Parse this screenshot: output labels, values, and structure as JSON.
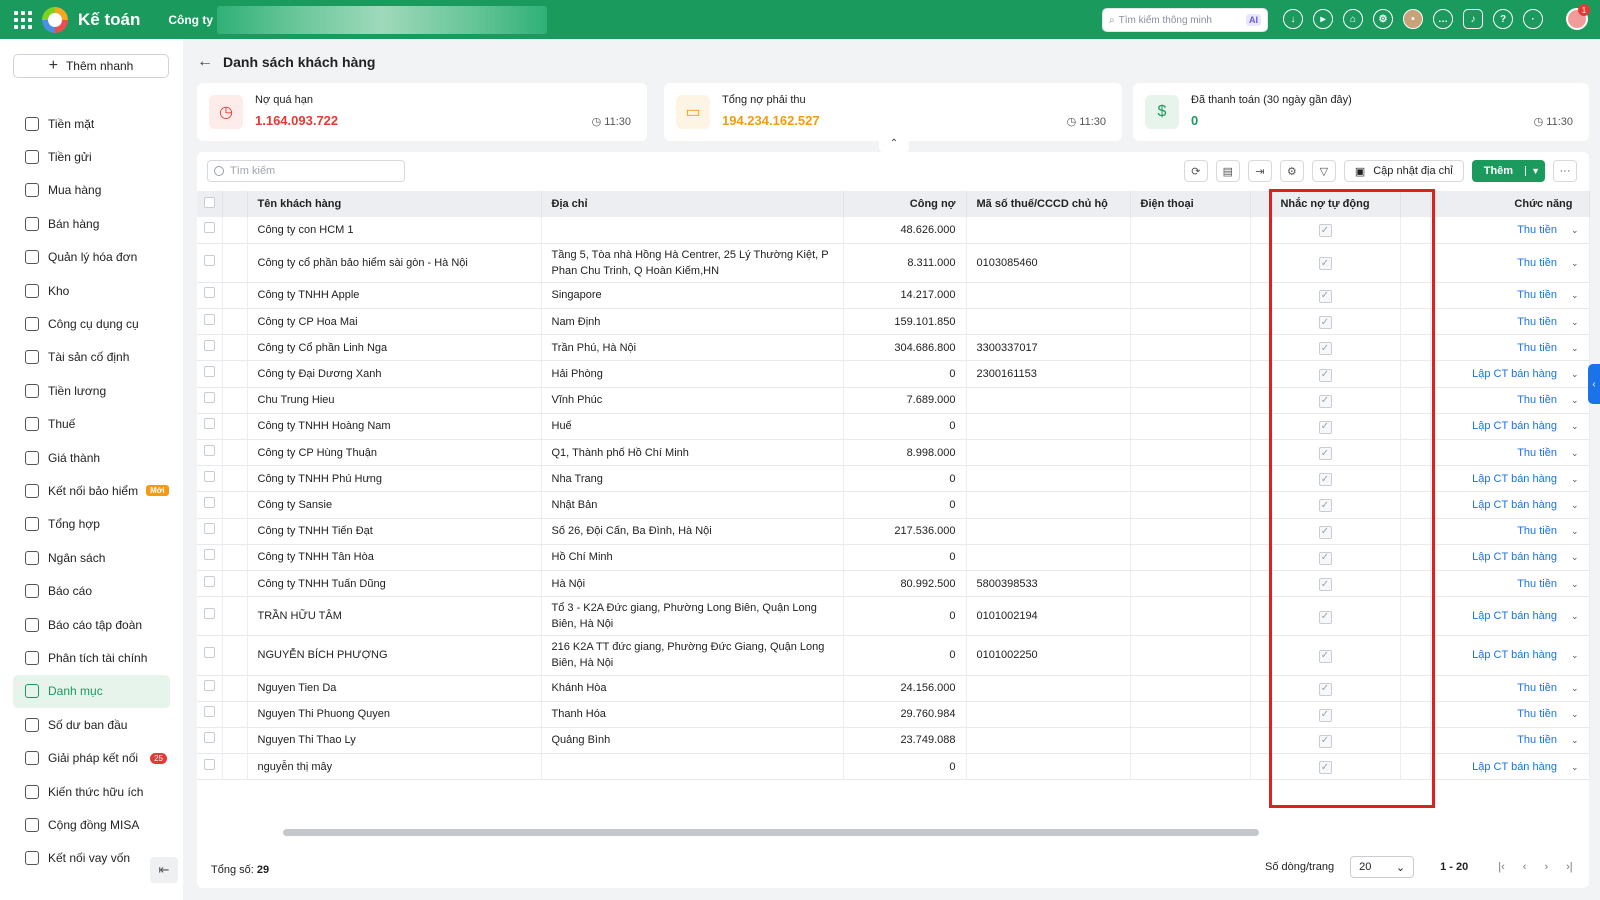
{
  "topbar": {
    "app_title": "Kế toán",
    "company_label": "Công ty",
    "search_placeholder": "Tìm kiếm thông minh",
    "search_ai": "AI",
    "notification_count": "1"
  },
  "sidebar": {
    "quick_add": "Thêm nhanh",
    "items": [
      {
        "label": "Tiền mặt",
        "icon": "cash-icon"
      },
      {
        "label": "Tiền gửi",
        "icon": "bank-icon"
      },
      {
        "label": "Mua hàng",
        "icon": "shopping-bag-icon"
      },
      {
        "label": "Bán hàng",
        "icon": "cart-icon"
      },
      {
        "label": "Quản lý hóa đơn",
        "icon": "invoice-icon"
      },
      {
        "label": "Kho",
        "icon": "warehouse-icon"
      },
      {
        "label": "Công cụ dụng cụ",
        "icon": "tools-icon"
      },
      {
        "label": "Tài sản cố định",
        "icon": "car-icon"
      },
      {
        "label": "Tiền lương",
        "icon": "salary-icon"
      },
      {
        "label": "Thuế",
        "icon": "tax-icon"
      },
      {
        "label": "Giá thành",
        "icon": "price-tag-icon"
      },
      {
        "label": "Kết nối bảo hiểm",
        "icon": "shield-icon",
        "tag": "Mới"
      },
      {
        "label": "Tổng hợp",
        "icon": "summary-icon"
      },
      {
        "label": "Ngân sách",
        "icon": "budget-icon"
      },
      {
        "label": "Báo cáo",
        "icon": "bar-chart-icon"
      },
      {
        "label": "Báo cáo tập đoàn",
        "icon": "line-chart-icon"
      },
      {
        "label": "Phân tích tài chính",
        "icon": "analysis-icon"
      },
      {
        "label": "Danh mục",
        "icon": "list-icon",
        "active": true
      },
      {
        "label": "Số dư ban đầu",
        "icon": "balance-icon"
      },
      {
        "label": "Giải pháp kết nối",
        "icon": "connect-icon",
        "count": "25"
      },
      {
        "label": "Kiến thức hữu ích",
        "icon": "bulb-icon"
      },
      {
        "label": "Cộng đồng MISA",
        "icon": "community-icon"
      },
      {
        "label": "Kết nối vay vốn",
        "icon": "loan-icon"
      }
    ]
  },
  "page": {
    "title": "Danh sách khách hàng"
  },
  "cards": [
    {
      "label": "Nợ quá hạn",
      "value": "1.164.093.722",
      "time": "11:30",
      "color": "#e53935",
      "bg": "#fdecea",
      "icon": "clock-icon"
    },
    {
      "label": "Tổng nợ phải thu",
      "value": "194.234.162.527",
      "time": "11:30",
      "color": "#f39c12",
      "bg": "#fef4e4",
      "icon": "money-icon"
    },
    {
      "label": "Đã thanh toán (30 ngày gần đây)",
      "value": "0",
      "time": "11:30",
      "color": "#1a9b5d",
      "bg": "#e6f4ec",
      "icon": "receipt-icon"
    }
  ],
  "toolbar": {
    "search_placeholder": "Tìm kiếm",
    "update_address": "Cập nhật địa chỉ",
    "add": "Thêm"
  },
  "table": {
    "headers": [
      "Tên khách hàng",
      "Địa chỉ",
      "Công nợ",
      "Mã số thuế/CCCD chủ hộ",
      "Điện thoại",
      "Nhắc nợ tự động",
      "Chức năng"
    ],
    "rows": [
      {
        "name": "Công ty con HCM 1",
        "address": "",
        "debt": "48.626.000",
        "tax": "",
        "phone": "",
        "action": "Thu tiền"
      },
      {
        "name": "Công ty cổ phần bảo hiểm sài gòn - Hà Nội",
        "address": "Tầng 5, Tòa nhà Hồng Hà Centrer, 25 Lý Thường Kiệt, P Phan Chu Trinh, Q Hoàn Kiếm,HN",
        "debt": "8.311.000",
        "tax": "0103085460",
        "phone": "",
        "action": "Thu tiền"
      },
      {
        "name": "Công ty TNHH Apple",
        "address": "Singapore",
        "debt": "14.217.000",
        "tax": "",
        "phone": "",
        "action": "Thu tiền"
      },
      {
        "name": "Công ty CP Hoa Mai",
        "address": "Nam Định",
        "debt": "159.101.850",
        "tax": "",
        "phone": "",
        "action": "Thu tiền"
      },
      {
        "name": "Công ty Cổ phần Linh Nga",
        "address": "Trần Phú, Hà Nội",
        "debt": "304.686.800",
        "tax": "3300337017",
        "phone": "",
        "action": "Thu tiền"
      },
      {
        "name": "Công ty Đại Dương Xanh",
        "address": "Hải Phòng",
        "debt": "0",
        "tax": "2300161153",
        "phone": "",
        "action": "Lập CT bán hàng"
      },
      {
        "name": "Chu Trung Hieu",
        "address": "Vĩnh Phúc",
        "debt": "7.689.000",
        "tax": "",
        "phone": "",
        "action": "Thu tiền"
      },
      {
        "name": "Công ty TNHH Hoàng Nam",
        "address": "Huế",
        "debt": "0",
        "tax": "",
        "phone": "",
        "action": "Lập CT bán hàng"
      },
      {
        "name": "Công ty CP Hùng Thuận",
        "address": "Q1, Thành phố Hồ Chí Minh",
        "debt": "8.998.000",
        "tax": "",
        "phone": "",
        "action": "Thu tiền"
      },
      {
        "name": "Công ty TNHH Phú Hưng",
        "address": "Nha Trang",
        "debt": "0",
        "tax": "",
        "phone": "",
        "action": "Lập CT bán hàng"
      },
      {
        "name": "Công ty Sansie",
        "address": "Nhật Bản",
        "debt": "0",
        "tax": "",
        "phone": "",
        "action": "Lập CT bán hàng"
      },
      {
        "name": "Công ty TNHH Tiến Đạt",
        "address": "Số 26, Đội Cấn, Ba Đình, Hà Nội",
        "debt": "217.536.000",
        "tax": "",
        "phone": "",
        "action": "Thu tiền"
      },
      {
        "name": "Công ty TNHH Tân Hòa",
        "address": "Hồ Chí Minh",
        "debt": "0",
        "tax": "",
        "phone": "",
        "action": "Lập CT bán hàng"
      },
      {
        "name": "Công ty TNHH Tuấn Dũng",
        "address": "Hà Nội",
        "debt": "80.992.500",
        "tax": "5800398533",
        "phone": "",
        "action": "Thu tiền"
      },
      {
        "name": "TRẦN HỮU TÂM",
        "address": "Tổ 3 - K2A  Đức giang, Phường Long Biên, Quận Long Biên, Hà Nội",
        "debt": "0",
        "tax": "0101002194",
        "phone": "",
        "action": "Lập CT bán hàng"
      },
      {
        "name": "NGUYỄN BÍCH PHƯỢNG",
        "address": "216 K2A TT đức giang, Phường Đức Giang, Quận Long Biên, Hà Nội",
        "debt": "0",
        "tax": "0101002250",
        "phone": "",
        "action": "Lập CT bán hàng"
      },
      {
        "name": "Nguyen Tien Da",
        "address": "Khánh Hòa",
        "debt": "24.156.000",
        "tax": "",
        "phone": "",
        "action": "Thu tiền"
      },
      {
        "name": "Nguyen Thi Phuong Quyen",
        "address": "Thanh Hóa",
        "debt": "29.760.984",
        "tax": "",
        "phone": "",
        "action": "Thu tiền"
      },
      {
        "name": "Nguyen Thi Thao Ly",
        "address": "Quảng Bình",
        "debt": "23.749.088",
        "tax": "",
        "phone": "",
        "action": "Thu tiền"
      },
      {
        "name": "nguyễn thị mây",
        "address": "",
        "debt": "0",
        "tax": "",
        "phone": "",
        "action": "Lập CT bán hàng"
      }
    ]
  },
  "footer": {
    "total_label": "Tổng số:",
    "total_value": "29",
    "rows_per_page_label": "Số dòng/trang",
    "rows_per_page": "20",
    "range": "1 - 20"
  },
  "colors": {
    "brand": "#1a9b5d",
    "link": "#1a73e8",
    "highlight": "#e02020"
  }
}
